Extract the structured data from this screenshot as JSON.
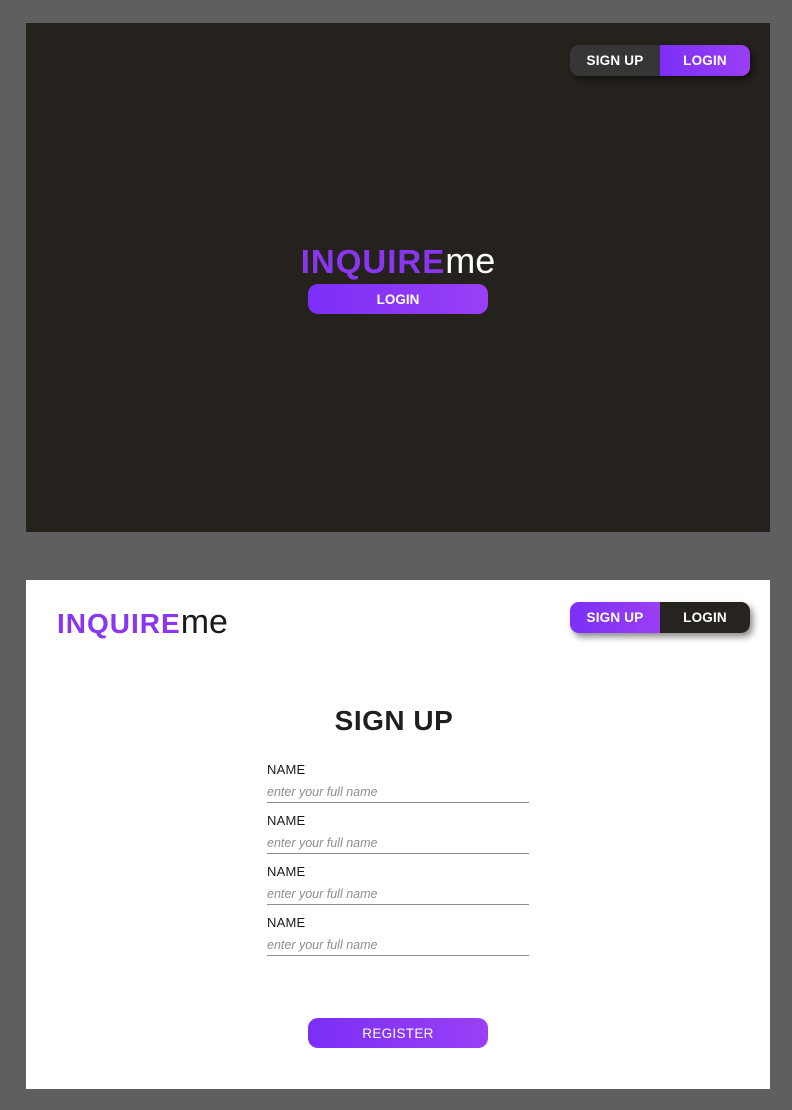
{
  "brand": {
    "name_bold": "INQUIRE",
    "name_light": "me"
  },
  "login_screen": {
    "toggle": {
      "signup_label": "SIGN UP",
      "login_label": "LOGIN"
    },
    "login_button": "LOGIN"
  },
  "signup_screen": {
    "toggle": {
      "signup_label": "SIGN UP",
      "login_label": "LOGIN"
    },
    "title": "SIGN UP",
    "fields": [
      {
        "label": "NAME",
        "placeholder": "enter your full name",
        "value": ""
      },
      {
        "label": "NAME",
        "placeholder": "enter your full name",
        "value": ""
      },
      {
        "label": "NAME",
        "placeholder": "enter your full name",
        "value": ""
      },
      {
        "label": "NAME",
        "placeholder": "enter your full name",
        "value": ""
      }
    ],
    "register_button": "REGISTER"
  },
  "colors": {
    "accent": "#8a35f0",
    "dark_bg": "#25211c",
    "page_bg": "#5f5f5f"
  }
}
